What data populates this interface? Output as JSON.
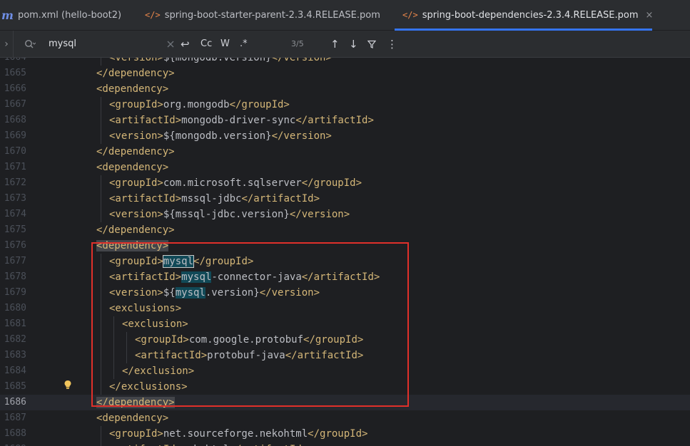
{
  "tabs": [
    {
      "icon": "m",
      "label": "pom.xml (hello-boot2)",
      "active": false
    },
    {
      "icon": "</>",
      "label": "spring-boot-starter-parent-2.3.4.RELEASE.pom",
      "active": false
    },
    {
      "icon": "</>",
      "label": "spring-boot-dependencies-2.3.4.RELEASE.pom",
      "active": true,
      "close": "×"
    }
  ],
  "search": {
    "expand_icon": "›",
    "search_icon": "Q",
    "query": "mysql",
    "replace_icon": "↩",
    "match_case": "Cc",
    "words": "W",
    "regex": ".*",
    "count": "3/5",
    "prev_icon": "↑",
    "next_icon": "↓",
    "filter_icon": "⊽",
    "more_icon": "⋮"
  },
  "editor": {
    "lines": [
      {
        "n": "1664",
        "segs": [
          [
            "t",
            "<version>"
          ],
          [
            "x",
            "${mongodb.version}"
          ],
          [
            "t",
            "</version>"
          ]
        ],
        "indent": 2
      },
      {
        "n": "1665",
        "segs": [
          [
            "t",
            "</dependency>"
          ]
        ],
        "indent": 1
      },
      {
        "n": "1666",
        "segs": [
          [
            "t",
            "<dependency>"
          ]
        ],
        "indent": 1
      },
      {
        "n": "1667",
        "segs": [
          [
            "t",
            "<groupId>"
          ],
          [
            "x",
            "org.mongodb"
          ],
          [
            "t",
            "</groupId>"
          ]
        ],
        "indent": 2
      },
      {
        "n": "1668",
        "segs": [
          [
            "t",
            "<artifactId>"
          ],
          [
            "x",
            "mongodb-driver-sync"
          ],
          [
            "t",
            "</artifactId>"
          ]
        ],
        "indent": 2
      },
      {
        "n": "1669",
        "segs": [
          [
            "t",
            "<version>"
          ],
          [
            "x",
            "${mongodb.version}"
          ],
          [
            "t",
            "</version>"
          ]
        ],
        "indent": 2
      },
      {
        "n": "1670",
        "segs": [
          [
            "t",
            "</dependency>"
          ]
        ],
        "indent": 1
      },
      {
        "n": "1671",
        "segs": [
          [
            "t",
            "<dependency>"
          ]
        ],
        "indent": 1
      },
      {
        "n": "1672",
        "segs": [
          [
            "t",
            "<groupId>"
          ],
          [
            "x",
            "com.microsoft.sqlserver"
          ],
          [
            "t",
            "</groupId>"
          ]
        ],
        "indent": 2
      },
      {
        "n": "1673",
        "segs": [
          [
            "t",
            "<artifactId>"
          ],
          [
            "x",
            "mssql-jdbc"
          ],
          [
            "t",
            "</artifactId>"
          ]
        ],
        "indent": 2
      },
      {
        "n": "1674",
        "segs": [
          [
            "t",
            "<version>"
          ],
          [
            "x",
            "${mssql-jdbc.version}"
          ],
          [
            "t",
            "</version>"
          ]
        ],
        "indent": 2
      },
      {
        "n": "1675",
        "segs": [
          [
            "t",
            "</dependency>"
          ]
        ],
        "indent": 1
      },
      {
        "n": "1676",
        "segs": [
          [
            "tb",
            "<dependency>"
          ]
        ],
        "indent": 1
      },
      {
        "n": "1677",
        "segs": [
          [
            "t",
            "<groupId>"
          ],
          [
            "hs",
            "mysql"
          ],
          [
            "t",
            "</groupId>"
          ]
        ],
        "indent": 2
      },
      {
        "n": "1678",
        "segs": [
          [
            "t",
            "<artifactId>"
          ],
          [
            "h",
            "mysql"
          ],
          [
            "x",
            "-connector-java"
          ],
          [
            "t",
            "</artifactId>"
          ]
        ],
        "indent": 2
      },
      {
        "n": "1679",
        "segs": [
          [
            "t",
            "<version>"
          ],
          [
            "x",
            "${"
          ],
          [
            "h",
            "mysql"
          ],
          [
            "x",
            ".version}"
          ],
          [
            "t",
            "</version>"
          ]
        ],
        "indent": 2
      },
      {
        "n": "1680",
        "segs": [
          [
            "t",
            "<exclusions>"
          ]
        ],
        "indent": 2
      },
      {
        "n": "1681",
        "segs": [
          [
            "t",
            "<exclusion>"
          ]
        ],
        "indent": 3
      },
      {
        "n": "1682",
        "segs": [
          [
            "t",
            "<groupId>"
          ],
          [
            "x",
            "com.google.protobuf"
          ],
          [
            "t",
            "</groupId>"
          ]
        ],
        "indent": 4
      },
      {
        "n": "1683",
        "segs": [
          [
            "t",
            "<artifactId>"
          ],
          [
            "x",
            "protobuf-java"
          ],
          [
            "t",
            "</artifactId>"
          ]
        ],
        "indent": 4
      },
      {
        "n": "1684",
        "segs": [
          [
            "t",
            "</exclusion>"
          ]
        ],
        "indent": 3
      },
      {
        "n": "1685",
        "segs": [
          [
            "t",
            "</exclusions>"
          ]
        ],
        "indent": 2
      },
      {
        "n": "1686",
        "segs": [
          [
            "tb",
            "</dependency>"
          ]
        ],
        "indent": 1,
        "current": true
      },
      {
        "n": "1687",
        "segs": [
          [
            "t",
            "<dependency>"
          ]
        ],
        "indent": 1
      },
      {
        "n": "1688",
        "segs": [
          [
            "t",
            "<groupId>"
          ],
          [
            "x",
            "net.sourceforge.nekohtml"
          ],
          [
            "t",
            "</groupId>"
          ]
        ],
        "indent": 2
      },
      {
        "n": "1689",
        "segs": [
          [
            "t",
            "<artifactId>"
          ],
          [
            "x",
            "nekohtml"
          ],
          [
            "t",
            "</artifactId>"
          ]
        ],
        "indent": 2
      }
    ]
  },
  "colors": {
    "tag": "#d5b778",
    "text": "#bcbec4",
    "match": "#114957",
    "highlight_box": "#e0302a",
    "active_tab_underline": "#3574f0"
  },
  "intention_icon": "bulb-icon"
}
